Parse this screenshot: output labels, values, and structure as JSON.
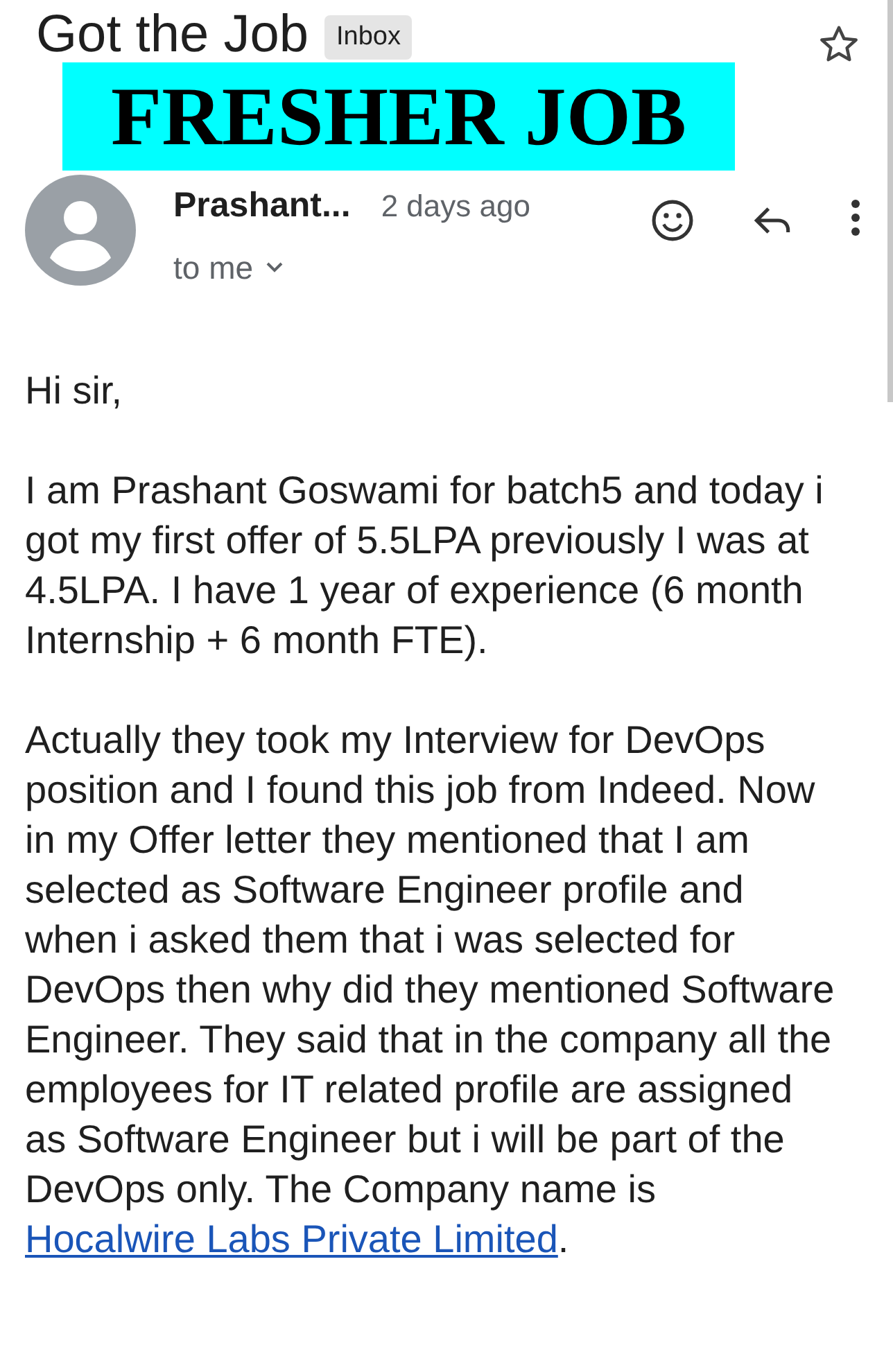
{
  "subject": "Got the Job",
  "label": "Inbox",
  "starred": false,
  "overlay_banner": "FRESHER JOB",
  "sender": {
    "name": "Prashant...",
    "time": "2 days ago",
    "recipient": "to me"
  },
  "body": [
    {
      "text": "Hi sir,"
    },
    {
      "text": "I am Prashant Goswami for batch5 and today i got my first offer of 5.5LPA previously I was at 4.5LPA. I have 1 year of experience (6 month Internship + 6 month FTE)."
    },
    {
      "text": "Actually they took my Interview for DevOps position and I found this job from Indeed. Now in my Offer letter they mentioned that I am selected as Software Engineer profile and when i asked them that i was selected for DevOps then why did they mentioned Software Engineer. They said that in the company all the employees for IT related profile are assigned as Software Engineer but i will be part of the DevOps only. The Company name is ",
      "link": "Hocalwire Labs Private Limited",
      "after": "."
    }
  ]
}
